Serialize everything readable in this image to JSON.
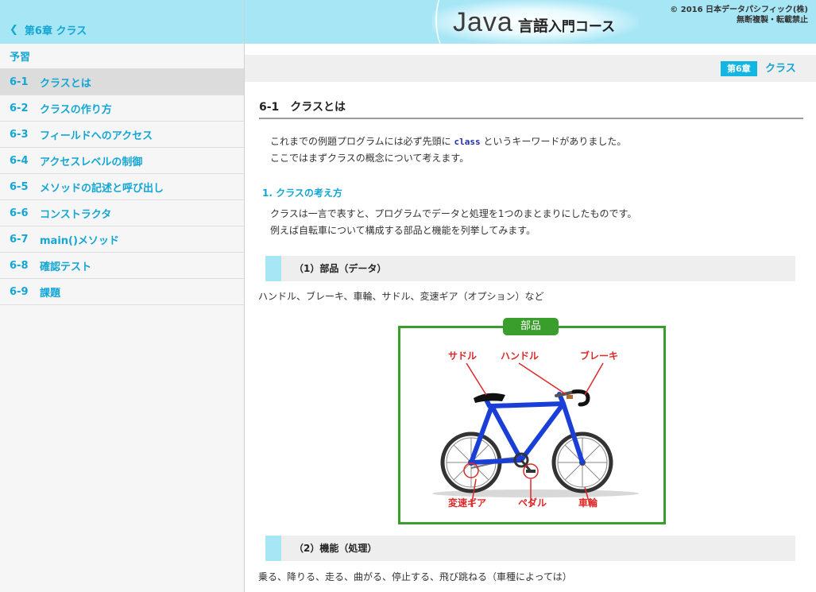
{
  "sidebar": {
    "back_label": "第6章 クラス",
    "items": [
      {
        "num": "",
        "label": "予習"
      },
      {
        "num": "6-1",
        "label": "クラスとは"
      },
      {
        "num": "6-2",
        "label": "クラスの作り方"
      },
      {
        "num": "6-3",
        "label": "フィールドへのアクセス"
      },
      {
        "num": "6-4",
        "label": "アクセスレベルの制御"
      },
      {
        "num": "6-5",
        "label": "メソッドの記述と呼び出し"
      },
      {
        "num": "6-6",
        "label": "コンストラクタ"
      },
      {
        "num": "6-7",
        "label": "main()メソッド"
      },
      {
        "num": "6-8",
        "label": "確認テスト"
      },
      {
        "num": "6-9",
        "label": "課題"
      }
    ],
    "active_index": 1
  },
  "header": {
    "logo_java": "Java",
    "logo_gengo": "言語",
    "logo_course": "入門コース",
    "copyright_line1": "© 2016 日本データパシフィック(株)",
    "copyright_line2": "無断複製・転載禁止"
  },
  "chapter": {
    "badge": "第6章",
    "name": "クラス"
  },
  "content": {
    "section_title": "6-1　クラスとは",
    "intro_line1_before": "これまでの例題プログラムには必ず先頭に ",
    "intro_keyword": "class",
    "intro_line1_after": " というキーワードがありました。",
    "intro_line2": "ここではまずクラスの概念について考えます。",
    "subheading": "1. クラスの考え方",
    "concept_line1": "クラスは一言で表すと、プログラムでデータと処理を1つのまとまりにしたものです。",
    "concept_line2": "例えば自転車について構成する部品と機能を列挙してみます。",
    "box1_label": "（1）部品（データ）",
    "parts_text": "ハンドル、ブレーキ、車輪、サドル、変速ギア（オプション）など",
    "box2_label": "（2）機能（処理）",
    "functions_text": "乗る、降りる、走る、曲がる、停止する、飛び跳ねる（車種によっては）"
  },
  "figure": {
    "title": "部品",
    "labels": {
      "saddle": "サドル",
      "handle": "ハンドル",
      "brake": "ブレーキ",
      "gear": "変速ギア",
      "pedal": "ペダル",
      "wheel": "車輪"
    }
  },
  "colors": {
    "accent": "#13a6d4",
    "header_bg": "#a6e6f5",
    "figure_green": "#3a9e2c",
    "label_red": "#e02828",
    "bike_blue": "#1a3fd6"
  }
}
